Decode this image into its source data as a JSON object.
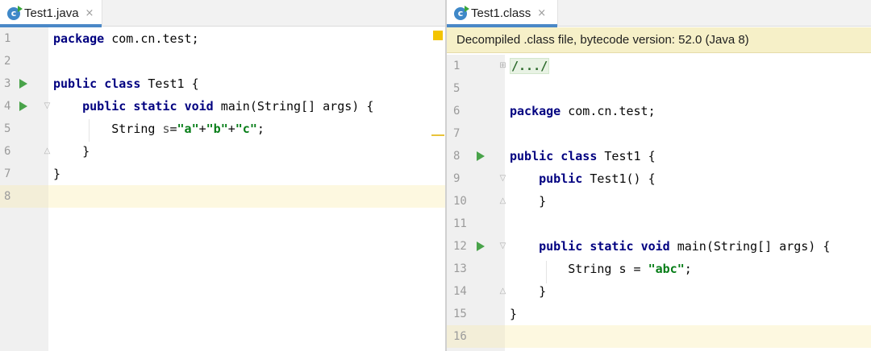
{
  "left_tab": {
    "label": "Test1.java",
    "close": "×"
  },
  "right_tab": {
    "label": "Test1.class",
    "close": "×"
  },
  "banner": {
    "text": "Decompiled .class file, bytecode version: 52.0 (Java 8)"
  },
  "left_lines": [
    {
      "num": "1",
      "segs": [
        {
          "t": "package",
          "c": "kw"
        },
        {
          "t": " com.cn.test;"
        }
      ]
    },
    {
      "num": "2",
      "segs": []
    },
    {
      "num": "3",
      "run": true,
      "segs": [
        {
          "t": "public",
          "c": "kw"
        },
        {
          "t": " "
        },
        {
          "t": "class",
          "c": "kw"
        },
        {
          "t": " Test1 {"
        }
      ]
    },
    {
      "num": "4",
      "run": true,
      "fold": "open",
      "segs": [
        {
          "t": "    "
        },
        {
          "t": "public",
          "c": "kw"
        },
        {
          "t": " "
        },
        {
          "t": "static",
          "c": "kw"
        },
        {
          "t": " "
        },
        {
          "t": "void",
          "c": "kw"
        },
        {
          "t": " main(String[] args) {"
        }
      ]
    },
    {
      "num": "5",
      "segs": [
        {
          "t": "        String "
        },
        {
          "t": "s",
          "c": "var"
        },
        {
          "t": "="
        },
        {
          "t": "\"a\"",
          "c": "str"
        },
        {
          "t": "+"
        },
        {
          "t": "\"b\"",
          "c": "str"
        },
        {
          "t": "+"
        },
        {
          "t": "\"c\"",
          "c": "str"
        },
        {
          "t": ";"
        }
      ]
    },
    {
      "num": "6",
      "fold": "close",
      "segs": [
        {
          "t": "    }"
        }
      ]
    },
    {
      "num": "7",
      "segs": [
        {
          "t": "}"
        }
      ]
    },
    {
      "num": "8",
      "current": true,
      "segs": []
    }
  ],
  "right_lines": [
    {
      "num": "1",
      "fold": "plus",
      "segs": [
        {
          "t": "/.../",
          "c": "folded"
        }
      ]
    },
    {
      "num": "5",
      "segs": []
    },
    {
      "num": "6",
      "segs": [
        {
          "t": "package",
          "c": "kw"
        },
        {
          "t": " com.cn.test;"
        }
      ]
    },
    {
      "num": "7",
      "segs": []
    },
    {
      "num": "8",
      "run": true,
      "segs": [
        {
          "t": "public",
          "c": "kw"
        },
        {
          "t": " "
        },
        {
          "t": "class",
          "c": "kw"
        },
        {
          "t": " Test1 {"
        }
      ]
    },
    {
      "num": "9",
      "fold": "open",
      "segs": [
        {
          "t": "    "
        },
        {
          "t": "public",
          "c": "kw"
        },
        {
          "t": " Test1() {"
        }
      ]
    },
    {
      "num": "10",
      "fold": "close",
      "segs": [
        {
          "t": "    }"
        }
      ]
    },
    {
      "num": "11",
      "segs": []
    },
    {
      "num": "12",
      "run": true,
      "fold": "open",
      "segs": [
        {
          "t": "    "
        },
        {
          "t": "public",
          "c": "kw"
        },
        {
          "t": " "
        },
        {
          "t": "static",
          "c": "kw"
        },
        {
          "t": " "
        },
        {
          "t": "void",
          "c": "kw"
        },
        {
          "t": " main(String[] args) {"
        }
      ]
    },
    {
      "num": "13",
      "segs": [
        {
          "t": "        String s = "
        },
        {
          "t": "\"abc\"",
          "c": "str"
        },
        {
          "t": ";"
        }
      ]
    },
    {
      "num": "14",
      "fold": "close",
      "segs": [
        {
          "t": "    }"
        }
      ]
    },
    {
      "num": "15",
      "segs": [
        {
          "t": "}"
        }
      ]
    },
    {
      "num": "16",
      "current": true,
      "segs": []
    }
  ],
  "icons": {
    "file": "java-class-file-icon",
    "run": "run-gutter-icon",
    "fold": "fold-marker-icon"
  },
  "colors": {
    "keyword": "#000080",
    "string": "#067d17",
    "tab_underline": "#4a88c7",
    "banner_bg": "#f6f0c8",
    "current_line": "#fdf8e0",
    "run_icon": "#49a34a",
    "warning": "#f3c400"
  }
}
